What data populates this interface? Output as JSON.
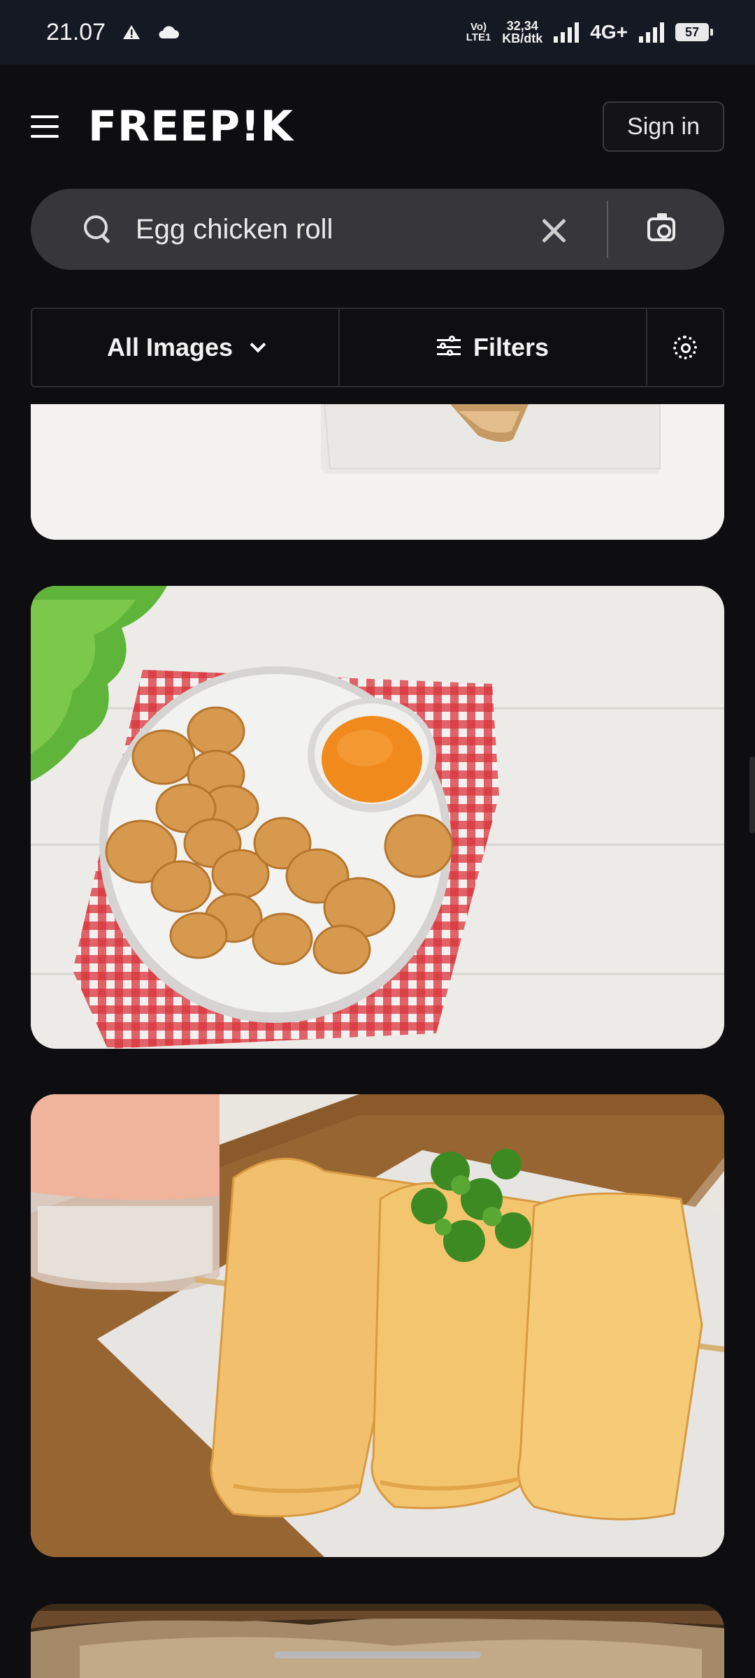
{
  "status_bar": {
    "time": "21.07",
    "volte": "Vo)\nLTE1",
    "net_speed_value": "32,34",
    "net_speed_unit": "KB/dtk",
    "network": "4G+",
    "battery": "57"
  },
  "header": {
    "logo": "FREEP!K",
    "sign_in": "Sign in"
  },
  "search": {
    "query": "Egg chicken roll"
  },
  "filters": {
    "type_label": "All Images",
    "filters_label": "Filters"
  }
}
